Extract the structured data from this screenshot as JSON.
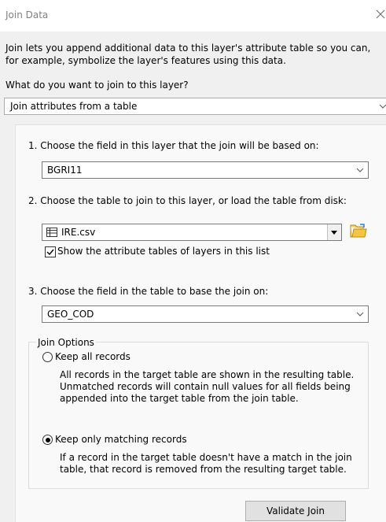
{
  "window": {
    "title": "Join Data"
  },
  "intro_text": "Join lets you append additional data to this layer's attribute table so you can, for example, symbolize the layer's features using this data.",
  "question": "What do you want to join to this layer?",
  "join_type_select": {
    "value": "Join attributes from a table"
  },
  "step1": {
    "label": "1.  Choose the field in this layer that the join will be based on:",
    "value": "BGRI11"
  },
  "step2": {
    "label": "2.  Choose the table to join to this layer, or load the table from disk:",
    "value": "IRE.csv",
    "checkbox_label": "Show the attribute tables of layers in this list",
    "checkbox_checked": true
  },
  "step3": {
    "label": "3.  Choose the field in the table to base the join on:",
    "value": "GEO_COD"
  },
  "join_options": {
    "label": "Join Options",
    "keep_all": {
      "label": "Keep all records",
      "selected": false,
      "desc": "All records in the target table are shown in the resulting table. Unmatched records will contain null values for all fields being appended into the target table from the join table."
    },
    "keep_matching": {
      "label": "Keep only matching records",
      "selected": true,
      "desc": "If a record in the target table doesn't have a match in the join table, that record is removed from the resulting target table."
    }
  },
  "buttons": {
    "validate": "Validate Join"
  }
}
